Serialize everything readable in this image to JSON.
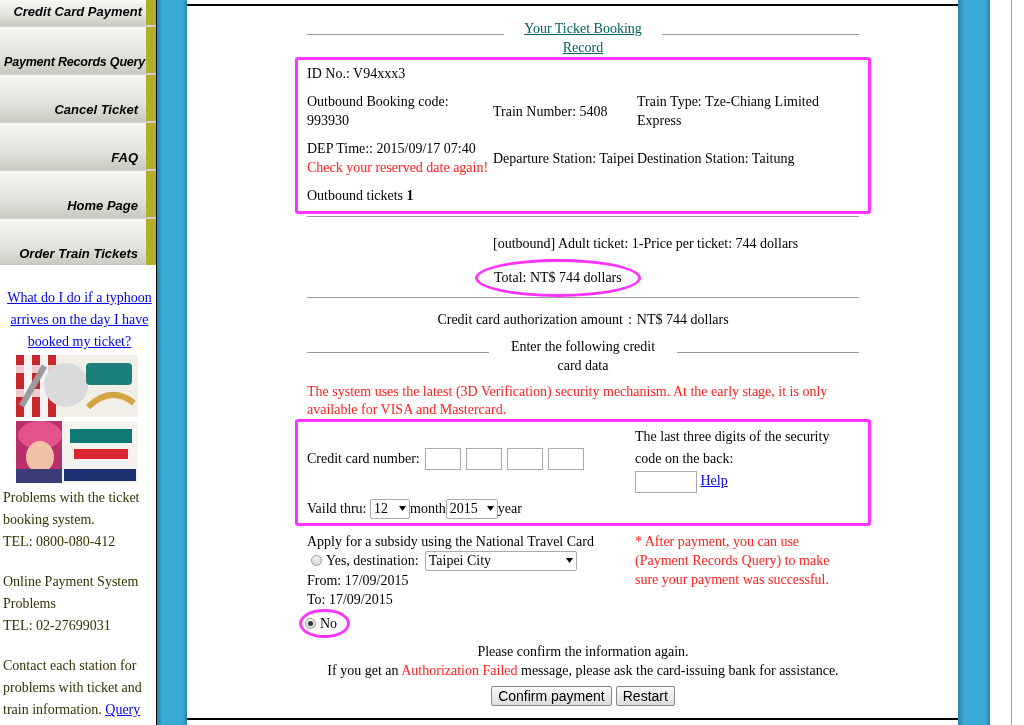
{
  "sidebar": {
    "menu": [
      {
        "label": "Credit Card Payment"
      },
      {
        "label": "Payment Records Query"
      },
      {
        "label": "Cancel Ticket"
      },
      {
        "label": "FAQ"
      },
      {
        "label": "Home Page"
      },
      {
        "label": "Order Train Tickets"
      }
    ],
    "typhoon_link": "What do I do if a typhoon arrives on the day I have booked my ticket?",
    "contacts": [
      {
        "lines": [
          "Problems with the ticket booking system.",
          "TEL: 0800-080-412"
        ]
      },
      {
        "lines": [
          "Online Payment System Problems",
          "TEL: 02-27699031"
        ]
      }
    ],
    "station_note": "Contact each station for problems with ticket and train information.",
    "station_link": "Query"
  },
  "main": {
    "heading": "Your Ticket Booking Record",
    "booking": {
      "highlighted": true,
      "id": "ID No.: V94xxx3",
      "booking_code": "Outbound Booking code: 993930",
      "train_number": "Train Number: 5408",
      "train_type": "Train Type: Tze-Chiang Limited Express",
      "dep_time": "DEP Time:: 2015/09/17 07:40",
      "warning": "Check your reserved date again!",
      "departure": "Departure Station: Taipei",
      "destination": "Destination Station: Taitung",
      "tickets_label": "Outbound tickets",
      "tickets_count": "1"
    },
    "price_line": "[outbound] Adult ticket: 1-Price per ticket: 744 dollars",
    "total": {
      "text": "Total: NT$ 744 dollars",
      "highlighted": true
    },
    "authorization": "Credit card authorization amount：NT$ 744 dollars",
    "card_heading": "Enter the following credit card data",
    "notice": "The system uses the latest (3D Verification) security mechanism. At the early stage, it is only available for VISA and Mastercard.",
    "card_form": {
      "highlighted": true,
      "number_label": "Credit card number:",
      "security_label": "The last three digits of the security code on the back:",
      "help_link": "Help",
      "valid_label": "Vaild thru:",
      "month": "12",
      "month_label": "month",
      "year": "2015",
      "year_label": "year"
    },
    "subsidy": {
      "title": "Apply for a subsidy using the National Travel Card",
      "yes": {
        "label": "Yes, destination:",
        "selected": false,
        "destination": "Taipei City"
      },
      "from": "From: 17/09/2015",
      "to": "To: 17/09/2015",
      "no": {
        "label": "No",
        "selected": true,
        "highlighted": true
      }
    },
    "after_note": "* After payment, you can use (Payment Records Query) to make sure your payment was successful.",
    "confirm_text": "Please confirm the information again.",
    "failed_parts": [
      "If you get an ",
      "Authorization Failed",
      " message, please ask the card-issuing bank for assistance."
    ],
    "buttons": [
      "Confirm payment",
      "Restart"
    ]
  }
}
